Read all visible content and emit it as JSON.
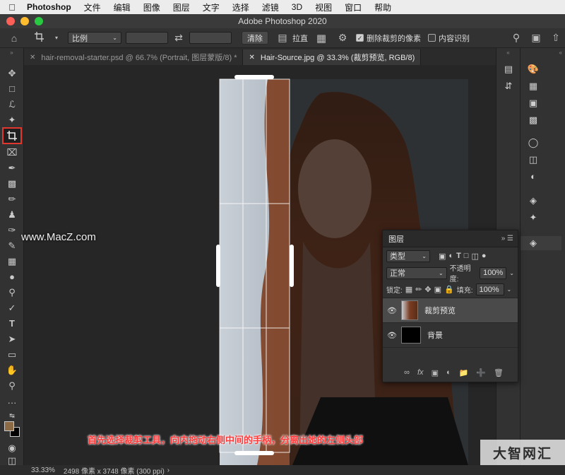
{
  "menubar": {
    "app": "Photoshop",
    "items": [
      "文件",
      "编辑",
      "图像",
      "图层",
      "文字",
      "选择",
      "滤镜",
      "3D",
      "视图",
      "窗口",
      "帮助"
    ]
  },
  "window": {
    "title": "Adobe Photoshop 2020"
  },
  "options": {
    "ratio_label": "比例",
    "clear_label": "清除",
    "straighten_label": "拉直",
    "delete_cropped_label": "删除裁剪的像素",
    "delete_cropped_checked": true,
    "content_aware_label": "内容识别",
    "content_aware_checked": false
  },
  "tabs": [
    {
      "label": "hair-removal-starter.psd @ 66.7% (Portrait, 图层蒙版/8) *",
      "active": false
    },
    {
      "label": "Hair-Source.jpg @ 33.3% (裁剪预览, RGB/8)",
      "active": true
    }
  ],
  "layers_panel": {
    "title": "图层",
    "filter_kind": "类型",
    "blend_mode": "正常",
    "opacity_label": "不透明度:",
    "opacity_value": "100%",
    "lock_label": "锁定:",
    "fill_label": "填充:",
    "fill_value": "100%",
    "layers": [
      {
        "name": "裁剪预览",
        "active": true
      },
      {
        "name": "背景",
        "active": false
      }
    ]
  },
  "status": {
    "zoom": "33.33%",
    "dimensions": "2498 像素 x 3748 像素 (300 ppi)"
  },
  "overlay": {
    "watermark": "www.MacZ.com",
    "caption": "首先选择裁剪工具，向内拖动右侧中间的手柄，分离出她的左侧头部",
    "brand": "大智网汇"
  },
  "colors": {
    "foreground": "#8b6a44",
    "background": "#000000",
    "accent_highlight": "#e0382e"
  }
}
